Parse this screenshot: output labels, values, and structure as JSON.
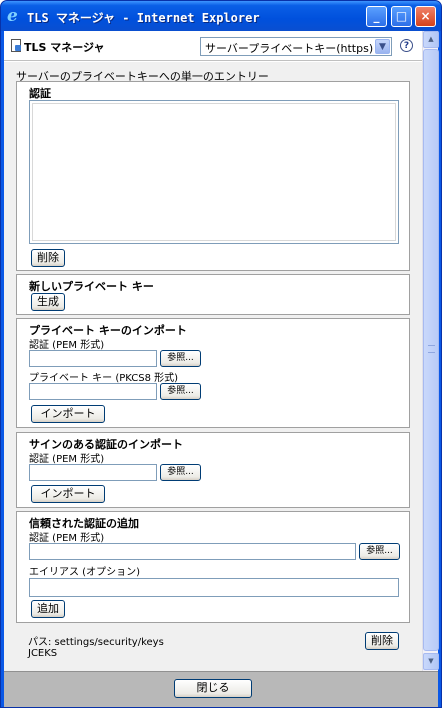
{
  "window": {
    "title": "TLS マネージャ - Internet Explorer",
    "controls": {
      "minimize": "_",
      "maximize": "□",
      "close": "×"
    }
  },
  "toolbar": {
    "app_title": "TLS マネージャ",
    "select_value": "サーバープライベートキー(https)",
    "help_label": "?"
  },
  "main": {
    "heading": "サーバーのプライベートキーへの単一のエントリー",
    "certificate": {
      "title": "認証",
      "textarea_value": "",
      "delete_label": "削除"
    },
    "new_key": {
      "title": "新しいプライベート キー",
      "generate_label": "生成"
    },
    "import_key": {
      "title": "プライベート キーのインポート",
      "cert_label": "認証 (PEM 形式)",
      "cert_value": "",
      "browse_label": "参照...",
      "key_label": "プライベート キー (PKCS8 形式)",
      "key_value": "",
      "browse2_label": "参照...",
      "import_label": "インポート"
    },
    "import_signed": {
      "title": "サインのある認証のインポート",
      "cert_label": "認証 (PEM 形式)",
      "cert_value": "",
      "browse_label": "参照...",
      "import_label": "インポート"
    },
    "add_trusted": {
      "title": "信頼された認証の追加",
      "cert_label": "認証 (PEM 形式)",
      "cert_value": "",
      "browse_label": "参照...",
      "alias_label": "エイリアス (オプション)",
      "alias_value": "",
      "add_label": "追加"
    },
    "footer": {
      "path": "パス: settings/security/keys",
      "keystore_type": "JCEKS",
      "delete_label": "削除"
    }
  },
  "bottom": {
    "close_label": "閉じる"
  },
  "icons": {
    "window_icon": "ie-icon",
    "app_icon": "document-lock-icon",
    "select_arrow": "chevron-down-icon",
    "help": "help-icon"
  },
  "colors": {
    "titlebar": "#0a5fe6",
    "content_bg": "#f0f0f0",
    "button_border": "#003c74"
  }
}
